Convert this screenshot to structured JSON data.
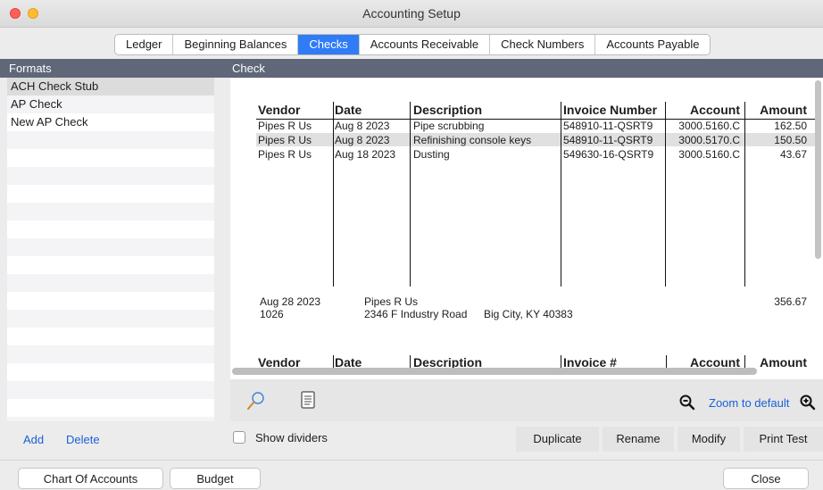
{
  "window": {
    "title": "Accounting Setup"
  },
  "tabs": [
    {
      "label": "Ledger"
    },
    {
      "label": "Beginning Balances"
    },
    {
      "label": "Checks",
      "active": true
    },
    {
      "label": "Accounts Receivable"
    },
    {
      "label": "Check Numbers"
    },
    {
      "label": "Accounts Payable"
    }
  ],
  "formats_panel": {
    "header": "Formats",
    "items": [
      "ACH Check Stub",
      "AP Check",
      "New AP Check"
    ],
    "selected": "ACH Check Stub",
    "add_label": "Add",
    "delete_label": "Delete"
  },
  "check_panel": {
    "header": "Check",
    "stub": {
      "columns": [
        "Vendor",
        "Date",
        "Description",
        "Invoice Number",
        "Account",
        "Amount"
      ],
      "rows": [
        [
          "Pipes R Us",
          "Aug 8 2023",
          "Pipe scrubbing",
          "548910-11-QSRT9",
          "3000.5160.C",
          "162.50"
        ],
        [
          "Pipes R Us",
          "Aug 8 2023",
          "Refinishing console keys",
          "548910-11-QSRT9",
          "3000.5170.C",
          "150.50"
        ],
        [
          "Pipes R Us",
          "Aug 18 2023",
          "Dusting",
          "549630-16-QSRT9",
          "3000.5160.C",
          "43.67"
        ]
      ]
    },
    "check_body": {
      "date": "Aug 28 2023",
      "check_number": "1026",
      "payee": "Pipes R Us",
      "address": "2346 F Industry Road",
      "city": "Big City, KY 40383",
      "amount": "356.67"
    },
    "second_stub_columns": [
      "Vendor",
      "Date",
      "Description",
      "Invoice #",
      "Account",
      "Amount"
    ],
    "zoom_label": "Zoom to default"
  },
  "options": {
    "show_dividers_label": "Show dividers",
    "show_dividers_checked": false
  },
  "actions": {
    "duplicate": "Duplicate",
    "rename": "Rename",
    "modify": "Modify",
    "print_test": "Print Test"
  },
  "bottom": {
    "chart_of_accounts": "Chart Of Accounts",
    "budget": "Budget",
    "close": "Close"
  },
  "icons": {
    "inspect": "magnifier-icon",
    "document": "document-icon",
    "zoom_out": "zoom-out-icon",
    "zoom_in": "zoom-in-icon"
  },
  "colors": {
    "accent": "#2f7cf6",
    "panel_header": "#5f6779",
    "link": "#1a5fd8"
  }
}
